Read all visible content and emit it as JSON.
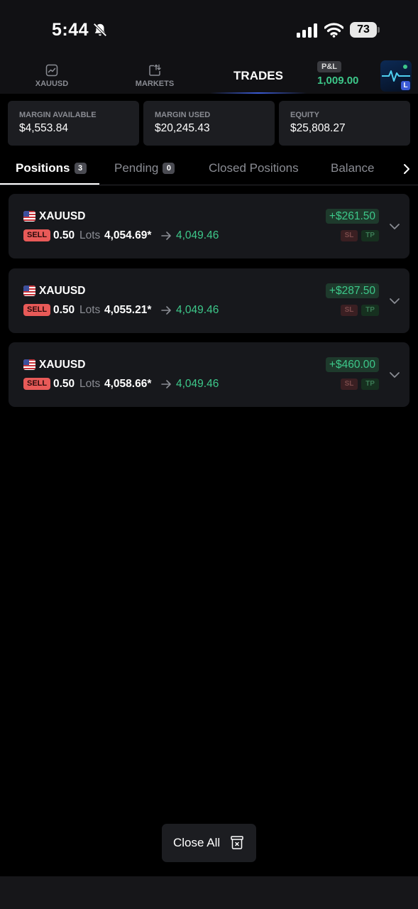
{
  "status_bar": {
    "time": "5:44",
    "battery": "73"
  },
  "top_nav": {
    "items": [
      {
        "label": "XAUUSD",
        "icon": "chart-icon"
      },
      {
        "label": "MARKETS",
        "icon": "markets-icon"
      },
      {
        "label": "TRADES"
      }
    ],
    "pnl_badge": "P&L",
    "pnl_value": "1,009.00",
    "avatar_badge": "L"
  },
  "stats": {
    "margin_available": {
      "label": "MARGIN AVAILABLE",
      "value": "$4,553.84"
    },
    "margin_used": {
      "label": "MARGIN USED",
      "value": "$20,245.43"
    },
    "equity": {
      "label": "EQUITY",
      "value": "$25,808.27"
    }
  },
  "tabs": [
    {
      "label": "Positions",
      "count": "3"
    },
    {
      "label": "Pending",
      "count": "0"
    },
    {
      "label": "Closed Positions"
    },
    {
      "label": "Balance"
    }
  ],
  "positions": [
    {
      "symbol": "XAUUSD",
      "side": "SELL",
      "lots": "0.50",
      "lots_label": "Lots",
      "open_price": "4,054.69*",
      "current_price": "4,049.46",
      "pnl": "+$261.50",
      "sl": "SL",
      "tp": "TP"
    },
    {
      "symbol": "XAUUSD",
      "side": "SELL",
      "lots": "0.50",
      "lots_label": "Lots",
      "open_price": "4,055.21*",
      "current_price": "4,049.46",
      "pnl": "+$287.50",
      "sl": "SL",
      "tp": "TP"
    },
    {
      "symbol": "XAUUSD",
      "side": "SELL",
      "lots": "0.50",
      "lots_label": "Lots",
      "open_price": "4,058.66*",
      "current_price": "4,049.46",
      "pnl": "+$460.00",
      "sl": "SL",
      "tp": "TP"
    }
  ],
  "close_all": {
    "label": "Close All"
  },
  "colors": {
    "profit": "#3dc88a",
    "sell": "#e85a58",
    "accent": "#3b5bd6",
    "card": "#17181c"
  }
}
